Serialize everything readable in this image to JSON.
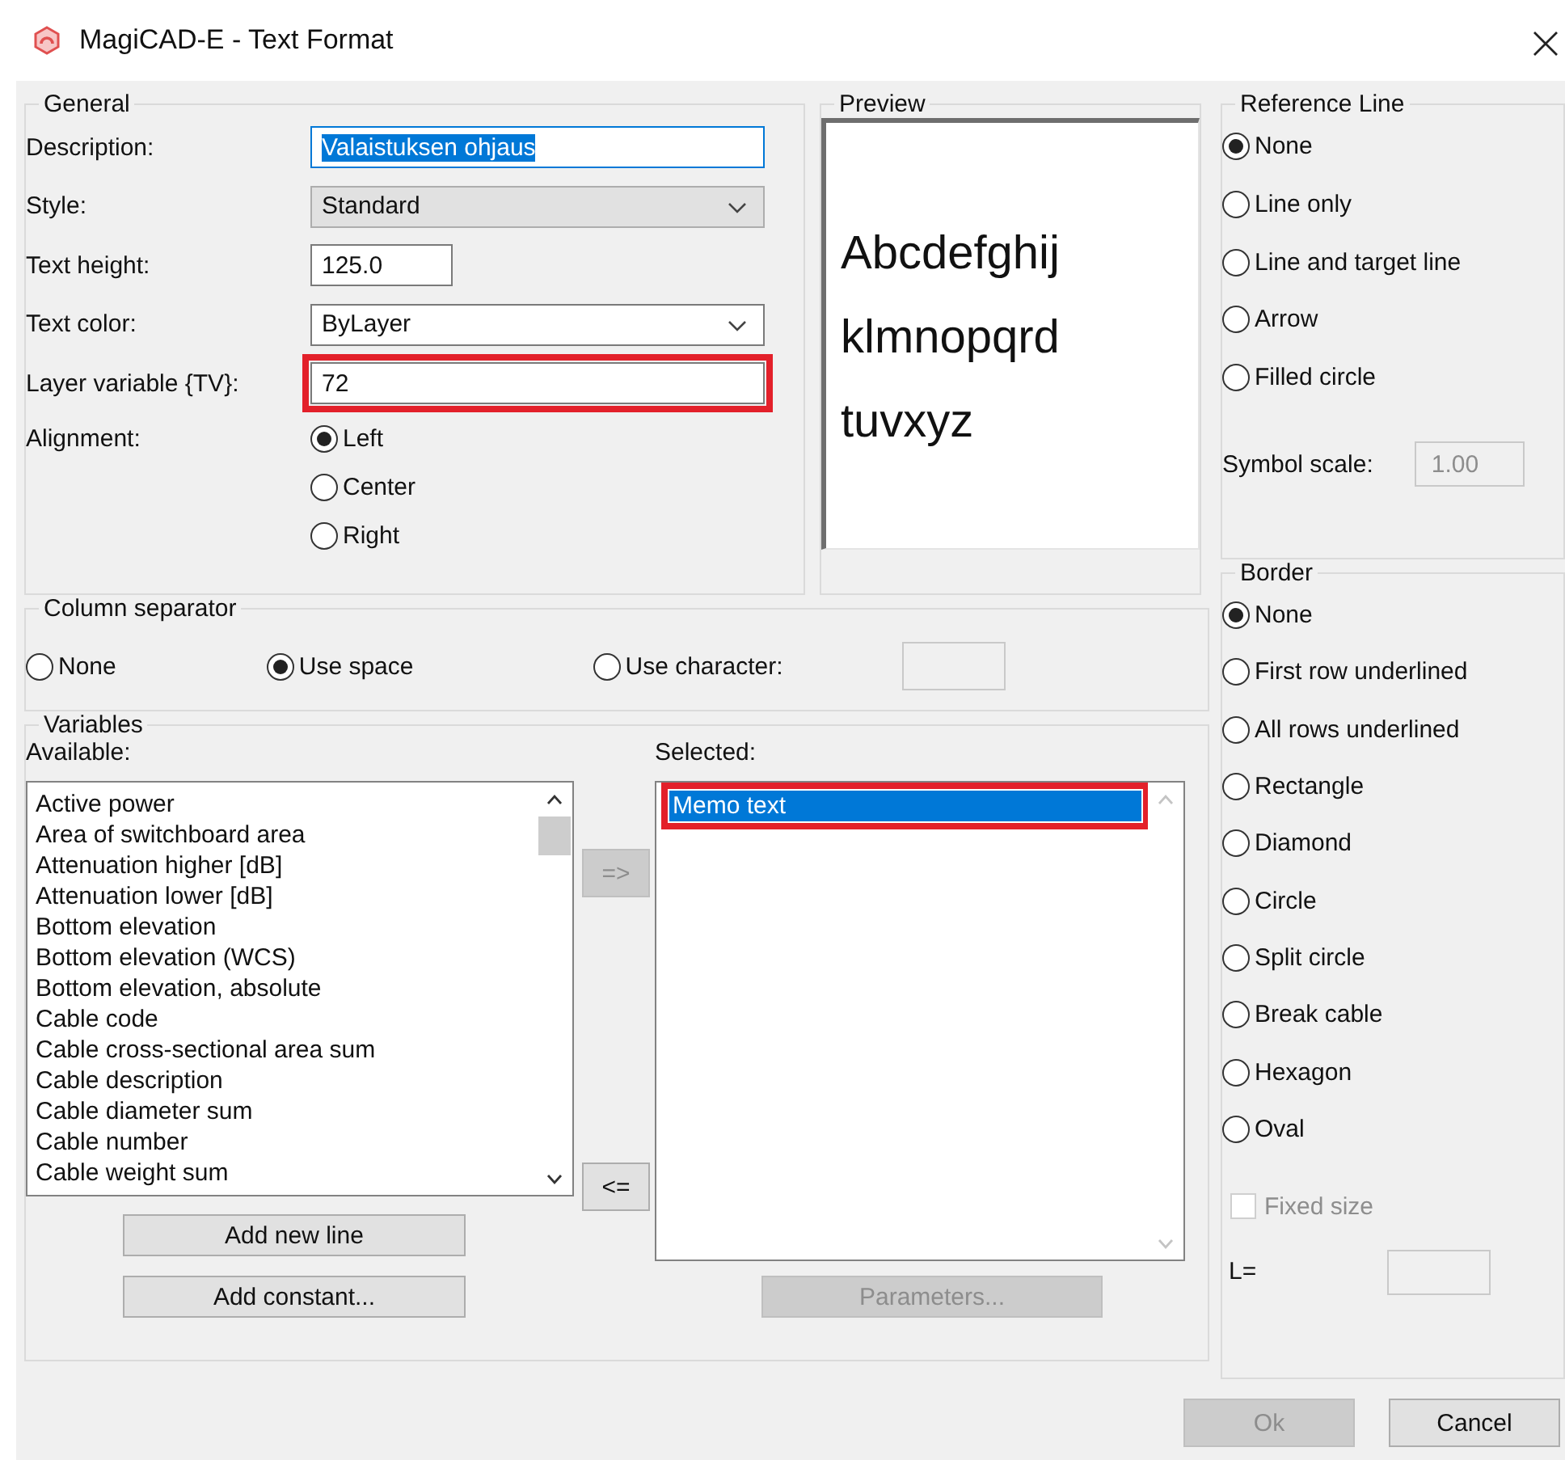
{
  "window": {
    "title": "MagiCAD-E - Text Format"
  },
  "general": {
    "title": "General",
    "fields": [
      {
        "label": "Description:",
        "kind": "text",
        "value": "Valaistuksen ohjaus",
        "focused": true,
        "highlighted": false
      },
      {
        "label": "Style:",
        "kind": "combo",
        "value": "Standard",
        "focused": false,
        "highlighted": false
      },
      {
        "label": "Text height:",
        "kind": "short",
        "value": "125.0",
        "focused": false,
        "highlighted": false
      },
      {
        "label": "Text color:",
        "kind": "dropdown",
        "value": "ByLayer",
        "focused": false,
        "highlighted": false
      },
      {
        "label": "Layer variable {TV}:",
        "kind": "text",
        "value": "72",
        "focused": false,
        "highlighted": true
      }
    ],
    "alignment": {
      "label": "Alignment:",
      "options": [
        {
          "label": "Left",
          "selected": true
        },
        {
          "label": "Center",
          "selected": false
        },
        {
          "label": "Right",
          "selected": false
        }
      ]
    }
  },
  "preview": {
    "title": "Preview",
    "lines": [
      "Abcdefghij",
      "klmnopqrd",
      "tuvxyz"
    ]
  },
  "reference_line": {
    "title": "Reference Line",
    "options": [
      {
        "label": "None",
        "selected": true
      },
      {
        "label": "Line only",
        "selected": false
      },
      {
        "label": "Line and target line",
        "selected": false
      },
      {
        "label": "Arrow",
        "selected": false
      },
      {
        "label": "Filled circle",
        "selected": false
      }
    ],
    "symbol_scale": {
      "label": "Symbol scale:",
      "value": "1.00",
      "disabled": true
    }
  },
  "column_separator": {
    "title": "Column separator",
    "options": [
      {
        "label": "None",
        "selected": false
      },
      {
        "label": "Use space",
        "selected": true
      },
      {
        "label": "Use character:",
        "selected": false
      }
    ],
    "character_field": {
      "disabled": true
    }
  },
  "variables": {
    "title": "Variables",
    "available": {
      "label": "Available:",
      "items": [
        "Active power",
        "Area of switchboard area",
        "Attenuation higher [dB]",
        "Attenuation lower [dB]",
        "Bottom elevation",
        "Bottom elevation (WCS)",
        "Bottom elevation, absolute",
        "Cable code",
        "Cable cross-sectional area sum",
        "Cable description",
        "Cable diameter sum",
        "Cable number",
        "Cable weight sum"
      ]
    },
    "move_buttons": [
      {
        "label": "=>",
        "disabled": true
      },
      {
        "label": "<=",
        "disabled": false
      }
    ],
    "selected": {
      "label": "Selected:",
      "items": [
        {
          "label": "Memo text",
          "selected": true,
          "highlighted": true
        }
      ]
    },
    "add_buttons": [
      {
        "label": "Add new line",
        "disabled": false
      },
      {
        "label": "Add constant...",
        "disabled": false
      }
    ],
    "parameters_button": {
      "label": "Parameters...",
      "disabled": true
    }
  },
  "border": {
    "title": "Border",
    "options": [
      {
        "label": "None",
        "selected": true
      },
      {
        "label": "First row underlined",
        "selected": false
      },
      {
        "label": "All rows underlined",
        "selected": false
      },
      {
        "label": "Rectangle",
        "selected": false
      },
      {
        "label": "Diamond",
        "selected": false
      },
      {
        "label": "Circle",
        "selected": false
      },
      {
        "label": "Split circle",
        "selected": false
      },
      {
        "label": "Break cable",
        "selected": false
      },
      {
        "label": "Hexagon",
        "selected": false
      },
      {
        "label": "Oval",
        "selected": false
      }
    ],
    "fixed_size": {
      "label": "Fixed size",
      "checked": false,
      "disabled": true
    },
    "length": {
      "label": "L="
    }
  },
  "buttons": [
    {
      "label": "Ok",
      "disabled": true
    },
    {
      "label": "Cancel",
      "disabled": false
    }
  ]
}
